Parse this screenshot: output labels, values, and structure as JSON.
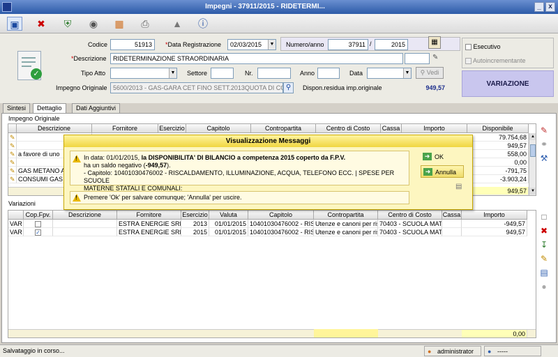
{
  "window": {
    "title": "Impegni - 37911/2015 - RIDETERMI...",
    "min": "_",
    "close": "x"
  },
  "toolbar": {
    "icons": [
      "save-icon",
      "delete-icon",
      "shield-icon",
      "cd-icon",
      "folder-copy-icon",
      "print-icon",
      "stamp-icon",
      "info-icon"
    ]
  },
  "header": {
    "codice_label": "Codice",
    "codice_value": "51913",
    "data_reg_label": "Data Registrazione",
    "data_reg_value": "02/03/2015",
    "numero_label": "Numero/anno",
    "numero_value": "37911",
    "anno_value": "2015",
    "descr_label": "Descrizione",
    "descr_value": "RIDETERMINAZIONE STRAORDINARIA",
    "tipo_label": "Tipo Atto",
    "settore_label": "Settore",
    "nr_label": "Nr.",
    "anno_label": "Anno",
    "data_label": "Data",
    "vedi_label": "Vedi",
    "impegno_label": "Impegno Originale",
    "impegno_value": "5600/2013 - GAS-GARA CET FINO SETT.2013QUOTA DI COMP",
    "dispon_label": "Dispon.residua imp.originale",
    "dispon_value": "949,57",
    "esecutivo_label": "Esecutivo",
    "autoinc_label": "Autoincrementante",
    "variazione_label": "VARIAZIONE"
  },
  "tabs": [
    "Sintesi",
    "Dettaglio",
    "Dati Aggiuntivi"
  ],
  "impegno_originale": {
    "section_label": "Impegno Originale",
    "columns": [
      "Descrizione",
      "Fornitore",
      "Esercizio",
      "Capitolo",
      "Contropartita",
      "Centro di Costo",
      "Cassa",
      "Importo",
      "Disponibile"
    ],
    "rows": [
      {
        "descr": "",
        "disp": "79.754,68"
      },
      {
        "descr": "",
        "disp": "949,57"
      },
      {
        "descr": "a favore di uno",
        "disp": "558,00"
      },
      {
        "descr": "",
        "disp": "0,00"
      },
      {
        "descr": "GAS METANO A",
        "disp": "-791,75"
      },
      {
        "descr": "CONSUMI GAS",
        "disp": "-3.903,24"
      }
    ],
    "total": "949,57"
  },
  "variazioni": {
    "section_label": "Variazioni",
    "columns": [
      "",
      "Cop.Fpv.",
      "Descrizione",
      "Fornitore",
      "Esercizio",
      "Valuta",
      "Capitolo",
      "Contropartita",
      "Centro di Costo",
      "Cassa",
      "Importo"
    ],
    "rows": [
      {
        "tipo": "VAR",
        "fpv": false,
        "descr": "",
        "fornitore": "ESTRA ENERGIE SRL",
        "esercizio": "2013",
        "valuta": "01/01/2015",
        "capitolo": "10401030476002 - RIS",
        "contro": "Utenze e canoni per ris",
        "centro": "70403 - SCUOLA MATE",
        "cassa": "",
        "importo": "-949,57"
      },
      {
        "tipo": "VAR",
        "fpv": true,
        "descr": "",
        "fornitore": "ESTRA ENERGIE SRL",
        "esercizio": "2015",
        "valuta": "01/01/2015",
        "capitolo": "10401030476002 - RIS",
        "contro": "Utenze e canoni per ris",
        "centro": "70403 - SCUOLA MATE",
        "cassa": "",
        "importo": "949,57"
      }
    ],
    "total": "0,00"
  },
  "dialog": {
    "title": "Visualizzazione Messaggi",
    "line1_pre": "In data: 01/01/2015, ",
    "line1_bold": "la DISPONIBILITA' DI BILANCIO a competenza 2015 coperto da F.P.V.",
    "line2_pre": "ha un saldo negativo (",
    "line2_bold": "-949,57",
    "line2_post": ").",
    "line3": "- Capitolo: 10401030476002 - RISCALDAMENTO, ILLUMINAZIONE, ACQUA, TELEFONO ECC. | SPESE PER SCUOLE",
    "line4": "MATERNE STATALI E COMUNALI:",
    "prompt": "Premere 'Ok' per salvare comunque; 'Annulla' per uscire.",
    "ok": "OK",
    "annulla": "Annulla"
  },
  "status": {
    "text": "Salvataggio in corso...",
    "user": "administrator",
    "other": "-----"
  }
}
